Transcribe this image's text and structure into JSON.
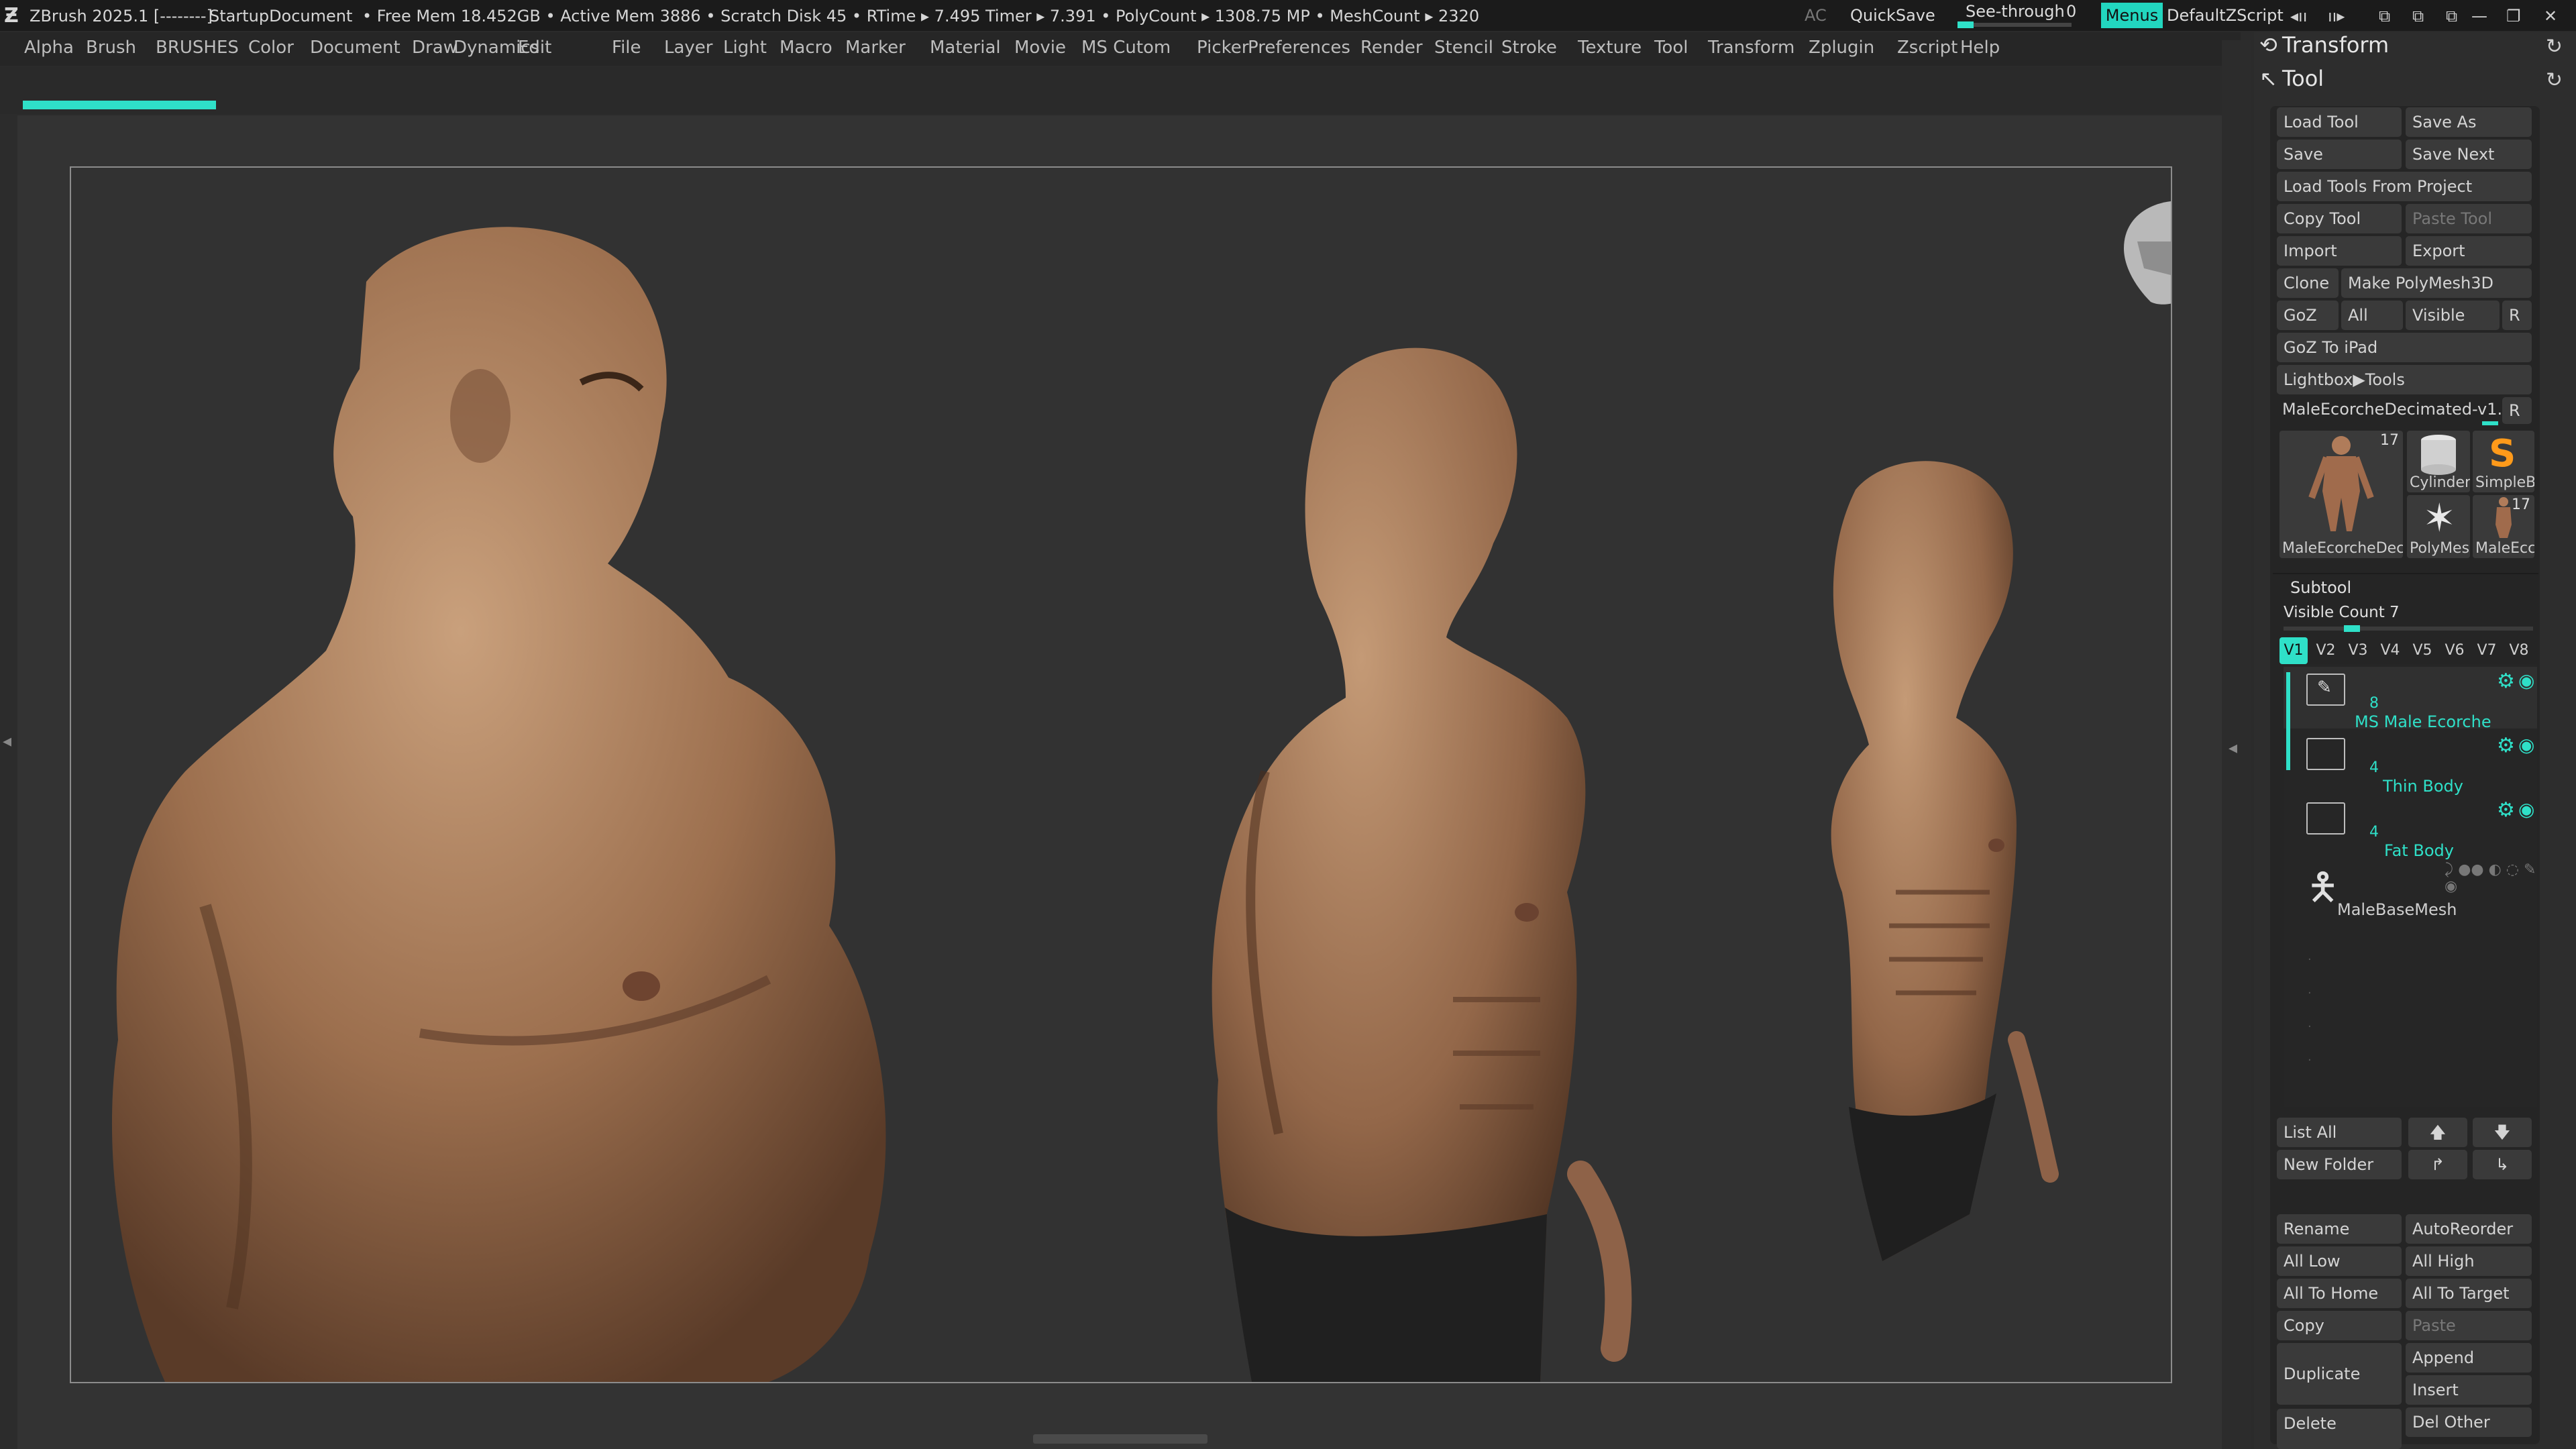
{
  "titlebar": {
    "app": "ZBrush 2025.1 [--------]",
    "document": "StartupDocument",
    "stats": "• Free Mem 18.452GB • Active Mem 3886 • Scratch Disk 45 • RTime ▸ 7.495 Timer ▸ 7.391 • PolyCount ▸ 1308.75 MP • MeshCount ▸ 2320",
    "ac": "AC",
    "quicksave": "QuickSave",
    "see_through_label": "See-through",
    "see_through_value": "0",
    "menus": "Menus",
    "script": "DefaultZScript"
  },
  "menubar": [
    "Alpha",
    "Brush",
    "BRUSHES",
    "Color",
    "Document",
    "Draw",
    "Dynamics",
    "Edit",
    "File",
    "Layer",
    "Light",
    "Macro",
    "Marker",
    "Material",
    "Movie",
    "MS Cutom",
    "Picker",
    "Preferences",
    "Render",
    "Stencil",
    "Stroke",
    "Texture",
    "Tool",
    "Transform",
    "Zplugin",
    "Zscript",
    "Help"
  ],
  "palette": {
    "transform_title": "Transform",
    "tool_title": "Tool",
    "buttons": {
      "load_tool": "Load Tool",
      "save_as": "Save As",
      "save": "Save",
      "save_next": "Save Next",
      "load_tools_from_project": "Load Tools From Project",
      "copy_tool": "Copy Tool",
      "paste_tool": "Paste Tool",
      "import": "Import",
      "export": "Export",
      "clone": "Clone",
      "make_polymesh3d": "Make PolyMesh3D",
      "goz": "GoZ",
      "all": "All",
      "visible": "Visible",
      "r": "R",
      "goz_to_ipad": "GoZ To iPad",
      "lightbox_tools": "Lightbox▶Tools"
    },
    "current_tool": "MaleEcorcheDecimated-v1.1",
    "current_tool_r": "R",
    "thumbs": [
      {
        "label": "MaleEcorcheDec",
        "count": "17"
      },
      {
        "label": "Cylinder"
      },
      {
        "label": "SimpleB"
      },
      {
        "label": "PolyMes"
      },
      {
        "label": "MaleEcc",
        "count": "17"
      }
    ],
    "subtool": {
      "title": "Subtool",
      "visible_count_label": "Visible Count 7",
      "tabs": [
        "V1",
        "V2",
        "V3",
        "V4",
        "V5",
        "V6",
        "V7",
        "V8"
      ],
      "rows": [
        {
          "count": "8",
          "name": "MS Male Ecorche"
        },
        {
          "count": "4",
          "name": "Thin Body"
        },
        {
          "count": "4",
          "name": "Fat Body"
        },
        {
          "name": "MaleBaseMesh"
        }
      ]
    },
    "bottom_buttons": {
      "list_all": "List All",
      "new_folder": "New Folder",
      "rename": "Rename",
      "autoreorder": "AutoReorder",
      "all_low": "All Low",
      "all_high": "All High",
      "all_to_home": "All To Home",
      "all_to_target": "All To Target",
      "copy": "Copy",
      "paste": "Paste",
      "duplicate": "Duplicate",
      "append": "Append",
      "insert": "Insert",
      "delete": "Delete",
      "del_other": "Del Other"
    }
  },
  "colors": {
    "accent": "#2fe0c8",
    "background": "#2b2b2b",
    "skin": "#b08060"
  },
  "icons": [
    "zbrush-logo-icon",
    "gear-icon",
    "eye-icon",
    "folder-icon",
    "refresh-icon",
    "arrow-up-icon",
    "arrow-down-icon"
  ]
}
